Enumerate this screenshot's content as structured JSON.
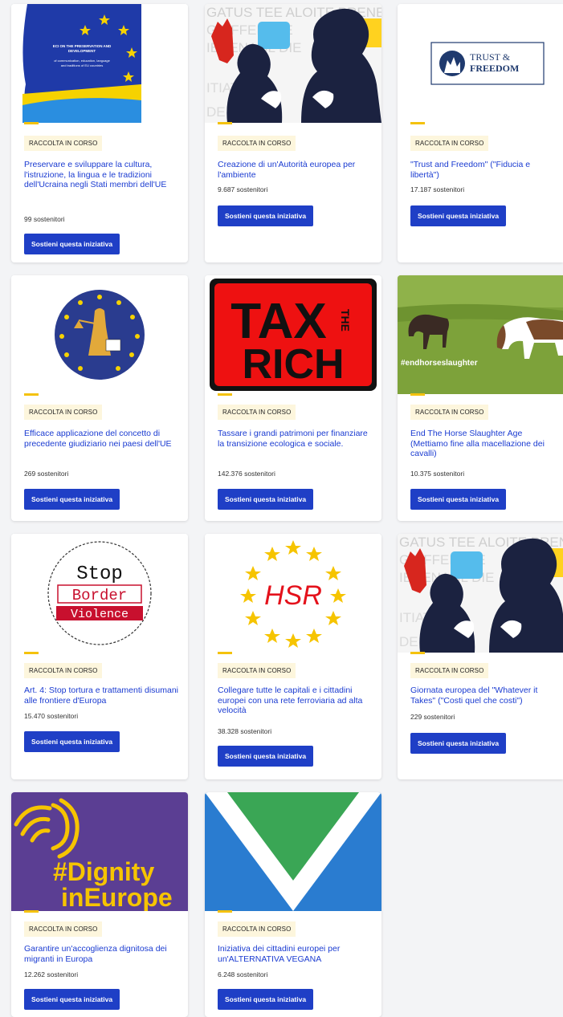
{
  "status_badge": "RACCOLTA IN CORSO",
  "cards": [
    {
      "title": "Preservare e sviluppare la cultura, l'istruzione, la lingua e le tradizioni dell'Ucraina negli Stati membri dell'UE",
      "supporters": "99 sostenitori",
      "button": "Sostieni questa iniziativa",
      "image_text": [
        "ECI ON THE PRESERVATION AND",
        "DEVELOPMENT",
        "of communication, education, language",
        "and traditions of EU countries"
      ]
    },
    {
      "title": "Creazione di un'Autorità europea per l'ambiente",
      "supporters": "9.687 sostenitori",
      "button": "Sostieni questa iniziativa",
      "image_text": [
        "GATUS TEE ALOITE PRENEZ",
        "GRIFFEN DIE",
        "IBRENAGL DIE",
        "ITIATIV",
        "DE IMALC"
      ]
    },
    {
      "title": "\"Trust and Freedom\" (\"Fiducia e libertà\")",
      "supporters": "17.187 sostenitori",
      "button": "Sostieni questa iniziativa",
      "image_text": [
        "TRUST &",
        "FREEDOM"
      ]
    },
    {
      "title": "Efficace applicazione del concetto di precedente giudiziario nei paesi dell'UE",
      "supporters": "269 sostenitori",
      "button": "Sostieni questa iniziativa",
      "image_text": []
    },
    {
      "title": "Tassare i grandi patrimoni per finanziare la transizione ecologica e sociale.",
      "supporters": "142.376 sostenitori",
      "button": "Sostieni questa iniziativa",
      "image_text": [
        "TAX",
        "THE",
        "RICH"
      ]
    },
    {
      "title": "End The Horse Slaughter Age (Mettiamo fine alla macellazione dei cavalli)",
      "supporters": "10.375 sostenitori",
      "button": "Sostieni questa iniziativa",
      "image_text": [
        "#endhorseslaughter"
      ]
    },
    {
      "title": "Art. 4: Stop tortura e trattamenti disumani alle frontiere d'Europa",
      "supporters": "15.470 sostenitori",
      "button": "Sostieni questa iniziativa",
      "image_text": [
        "Stop",
        "Border",
        "Violence"
      ]
    },
    {
      "title": "Collegare tutte le capitali e i cittadini europei con una rete ferroviaria ad alta velocità",
      "supporters": "38.328 sostenitori",
      "button": "Sostieni questa iniziativa",
      "image_text": [
        "HSR"
      ]
    },
    {
      "title": "Giornata europea del \"Whatever it Takes\" (\"Costi quel che costi\")",
      "supporters": "229 sostenitori",
      "button": "Sostieni questa iniziativa",
      "image_text": [
        "GATUS TEE ALOITE PRENEZ",
        "GRIFFEN DIE",
        "IBRENAGL DIE",
        "ITIATIV",
        "DE IMALC"
      ]
    },
    {
      "title": "Garantire un'accoglienza dignitosa dei migranti in Europa",
      "supporters": "12.262 sostenitori",
      "button": "Sostieni questa iniziativa",
      "image_text": [
        "#Dignity",
        "inEurope"
      ]
    },
    {
      "title": "Iniziativa dei cittadini europei per un'ALTERNATIVA VEGANA",
      "supporters": "6.248 sostenitori",
      "button": "Sostieni questa iniziativa",
      "image_text": []
    }
  ],
  "colors": {
    "accent": "#f4c20d",
    "link": "#1a3bd1",
    "button": "#1f3fc6",
    "badge_bg": "#fdf6dd"
  }
}
